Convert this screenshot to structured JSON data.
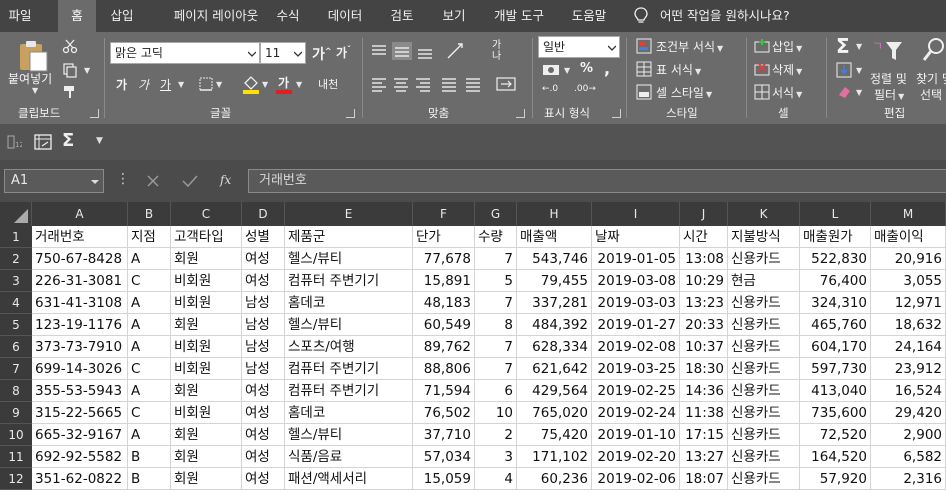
{
  "tabs": [
    "파일",
    "홈",
    "삽입",
    "페이지 레이아웃",
    "수식",
    "데이터",
    "검토",
    "보기",
    "개발 도구",
    "도움말"
  ],
  "active_tab": "홈",
  "tell_me": "어떤 작업을 원하시나요?",
  "ribbon": {
    "clipboard": {
      "label": "클립보드",
      "paste": "붙여넣기"
    },
    "font": {
      "label": "글꼴",
      "name": "맑은 고딕",
      "size": "11",
      "wrap_label": "내천"
    },
    "align": {
      "label": "맞춤"
    },
    "number": {
      "label": "표시 형식",
      "format": "일반"
    },
    "styles": {
      "label": "스타일",
      "conditional": "조건부 서식",
      "table": "표 서식",
      "cell_style": "셀 스타일"
    },
    "cells": {
      "label": "셀",
      "insert": "삽입",
      "delete": "삭제",
      "format": "서식"
    },
    "editing": {
      "label": "편집",
      "sort_filter": "정렬 및",
      "sort_filter2": "필터",
      "find_select": "찾기 및",
      "find_select2": "선택"
    }
  },
  "formula_bar": {
    "name_box": "A1",
    "fx": "fx",
    "value": "거래번호"
  },
  "columns": [
    "A",
    "B",
    "C",
    "D",
    "E",
    "F",
    "G",
    "H",
    "I",
    "J",
    "K",
    "L",
    "M"
  ],
  "row_numbers": [
    "1",
    "2",
    "3",
    "4",
    "5",
    "6",
    "7",
    "8",
    "9",
    "10",
    "11",
    "12"
  ],
  "rows": [
    [
      "거래번호",
      "지점",
      "고객타입",
      "성별",
      "제품군",
      "단가",
      "수량",
      "매출액",
      "날짜",
      "시간",
      "지불방식",
      "매출원가",
      "매출이익"
    ],
    [
      "750-67-8428",
      "A",
      "회원",
      "여성",
      "헬스/뷰티",
      "77,678",
      "7",
      "543,746",
      "2019-01-05",
      "13:08",
      "신용카드",
      "522,830",
      "20,916"
    ],
    [
      "226-31-3081",
      "C",
      "비회원",
      "여성",
      "컴퓨터 주변기기",
      "15,891",
      "5",
      "79,455",
      "2019-03-08",
      "10:29",
      "현금",
      "76,400",
      "3,055"
    ],
    [
      "631-41-3108",
      "A",
      "비회원",
      "남성",
      "홈데코",
      "48,183",
      "7",
      "337,281",
      "2019-03-03",
      "13:23",
      "신용카드",
      "324,310",
      "12,971"
    ],
    [
      "123-19-1176",
      "A",
      "회원",
      "남성",
      "헬스/뷰티",
      "60,549",
      "8",
      "484,392",
      "2019-01-27",
      "20:33",
      "신용카드",
      "465,760",
      "18,632"
    ],
    [
      "373-73-7910",
      "A",
      "비회원",
      "남성",
      "스포츠/여행",
      "89,762",
      "7",
      "628,334",
      "2019-02-08",
      "10:37",
      "신용카드",
      "604,170",
      "24,164"
    ],
    [
      "699-14-3026",
      "C",
      "비회원",
      "남성",
      "컴퓨터 주변기기",
      "88,806",
      "7",
      "621,642",
      "2019-03-25",
      "18:30",
      "신용카드",
      "597,730",
      "23,912"
    ],
    [
      "355-53-5943",
      "A",
      "회원",
      "여성",
      "컴퓨터 주변기기",
      "71,594",
      "6",
      "429,564",
      "2019-02-25",
      "14:36",
      "신용카드",
      "413,040",
      "16,524"
    ],
    [
      "315-22-5665",
      "C",
      "비회원",
      "여성",
      "홈데코",
      "76,502",
      "10",
      "765,020",
      "2019-02-24",
      "11:38",
      "신용카드",
      "735,600",
      "29,420"
    ],
    [
      "665-32-9167",
      "A",
      "회원",
      "여성",
      "헬스/뷰티",
      "37,710",
      "2",
      "75,420",
      "2019-01-10",
      "17:15",
      "신용카드",
      "72,520",
      "2,900"
    ],
    [
      "692-92-5582",
      "B",
      "회원",
      "여성",
      "식품/음료",
      "57,034",
      "3",
      "171,102",
      "2019-02-20",
      "13:27",
      "신용카드",
      "164,520",
      "6,582"
    ],
    [
      "351-62-0822",
      "B",
      "회원",
      "여성",
      "패션/액세서리",
      "15,059",
      "4",
      "60,236",
      "2019-02-06",
      "18:07",
      "신용카드",
      "57,920",
      "2,316"
    ]
  ],
  "colors": {
    "tab_bar": "#444444",
    "ribbon": "#6b6b6b",
    "header": "#3b3b3b",
    "grid_line": "#d4d4d4",
    "font_color_red": "#e02020",
    "highlight_yellow": "#ffe000"
  }
}
